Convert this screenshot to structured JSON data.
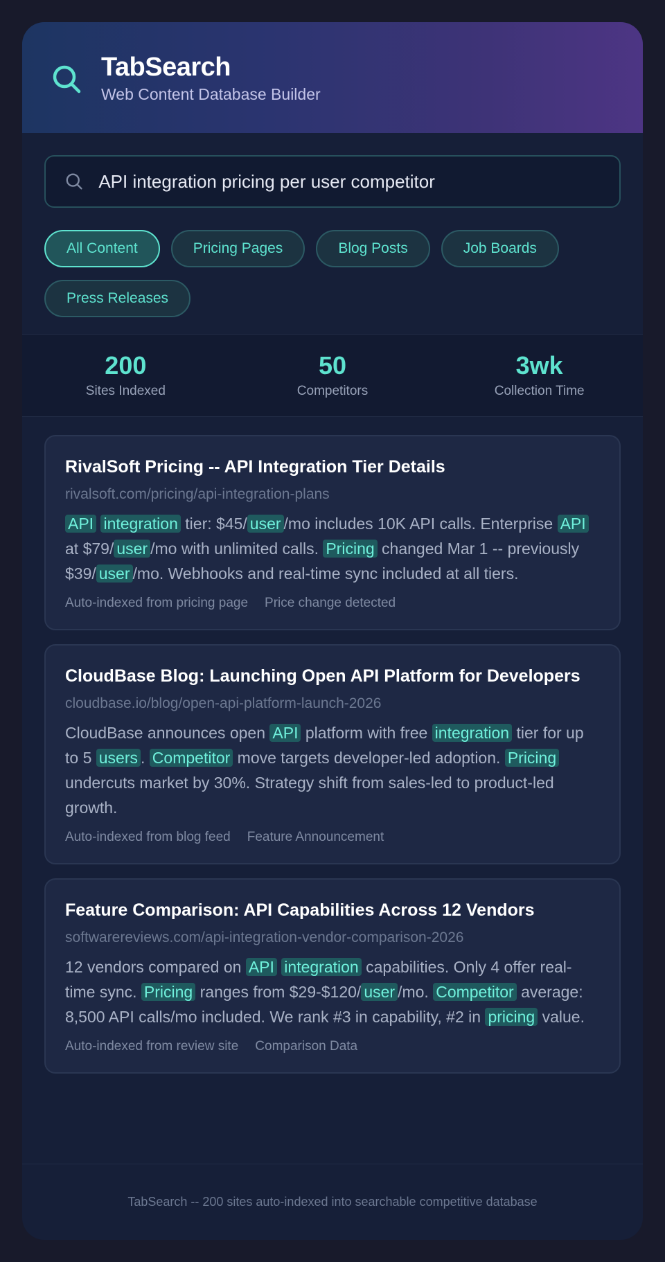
{
  "app": {
    "title": "TabSearch",
    "subtitle": "Web Content Database Builder"
  },
  "search": {
    "value": "API integration pricing per user competitor"
  },
  "filters": [
    {
      "label": "All Content",
      "active": true
    },
    {
      "label": "Pricing Pages",
      "active": false
    },
    {
      "label": "Blog Posts",
      "active": false
    },
    {
      "label": "Job Boards",
      "active": false
    },
    {
      "label": "Press Releases",
      "active": false
    }
  ],
  "stats": [
    {
      "value": "200",
      "label": "Sites Indexed"
    },
    {
      "value": "50",
      "label": "Competitors"
    },
    {
      "value": "3wk",
      "label": "Collection Time"
    }
  ],
  "results": [
    {
      "title": "RivalSoft Pricing -- API Integration Tier Details",
      "url": "rivalsoft.com/pricing/api-integration-plans",
      "snippet": [
        {
          "t": "API",
          "h": true
        },
        {
          "t": " ",
          "h": false
        },
        {
          "t": "integration",
          "h": true
        },
        {
          "t": " tier: $45/",
          "h": false
        },
        {
          "t": "user",
          "h": true
        },
        {
          "t": "/mo includes 10K API calls. Enterprise ",
          "h": false
        },
        {
          "t": "API",
          "h": true
        },
        {
          "t": " at $79/",
          "h": false
        },
        {
          "t": "user",
          "h": true
        },
        {
          "t": "/mo with unlimited calls. ",
          "h": false
        },
        {
          "t": "Pricing",
          "h": true
        },
        {
          "t": " changed Mar 1 -- previously $39/",
          "h": false
        },
        {
          "t": "user",
          "h": true
        },
        {
          "t": "/mo. Webhooks and real-time sync included at all tiers.",
          "h": false
        }
      ],
      "meta": [
        "Auto-indexed from pricing page",
        "Price change detected"
      ]
    },
    {
      "title": "CloudBase Blog: Launching Open API Platform for Developers",
      "url": "cloudbase.io/blog/open-api-platform-launch-2026",
      "snippet": [
        {
          "t": "CloudBase announces open ",
          "h": false
        },
        {
          "t": "API",
          "h": true
        },
        {
          "t": " platform with free ",
          "h": false
        },
        {
          "t": "integration",
          "h": true
        },
        {
          "t": " tier for up to 5 ",
          "h": false
        },
        {
          "t": "users",
          "h": true
        },
        {
          "t": ". ",
          "h": false
        },
        {
          "t": "Competitor",
          "h": true
        },
        {
          "t": " move targets developer-led adoption. ",
          "h": false
        },
        {
          "t": "Pricing",
          "h": true
        },
        {
          "t": " undercuts market by 30%. Strategy shift from sales-led to product-led growth.",
          "h": false
        }
      ],
      "meta": [
        "Auto-indexed from blog feed",
        "Feature Announcement"
      ]
    },
    {
      "title": "Feature Comparison: API Capabilities Across 12 Vendors",
      "url": "softwarereviews.com/api-integration-vendor-comparison-2026",
      "snippet": [
        {
          "t": "12 vendors compared on ",
          "h": false
        },
        {
          "t": "API",
          "h": true
        },
        {
          "t": " ",
          "h": false
        },
        {
          "t": "integration",
          "h": true
        },
        {
          "t": " capabilities. Only 4 offer real-time sync. ",
          "h": false
        },
        {
          "t": "Pricing",
          "h": true
        },
        {
          "t": " ranges from $29-$120/",
          "h": false
        },
        {
          "t": "user",
          "h": true
        },
        {
          "t": "/mo. ",
          "h": false
        },
        {
          "t": "Competitor",
          "h": true
        },
        {
          "t": " average: 8,500 API calls/mo included. We rank #3 in capability, #2 in ",
          "h": false
        },
        {
          "t": "pricing",
          "h": true
        },
        {
          "t": " value.",
          "h": false
        }
      ],
      "meta": [
        "Auto-indexed from review site",
        "Comparison Data"
      ]
    }
  ],
  "footer": {
    "text": "TabSearch -- 200 sites auto-indexed into searchable competitive database"
  },
  "colors": {
    "accent": "#5ee3cf",
    "highlight_bg": "#1f5a5e",
    "header_gradient_start": "#1d3562",
    "header_gradient_end": "#4d3584"
  },
  "icons": {
    "logo": "search-icon",
    "search": "search-icon"
  }
}
